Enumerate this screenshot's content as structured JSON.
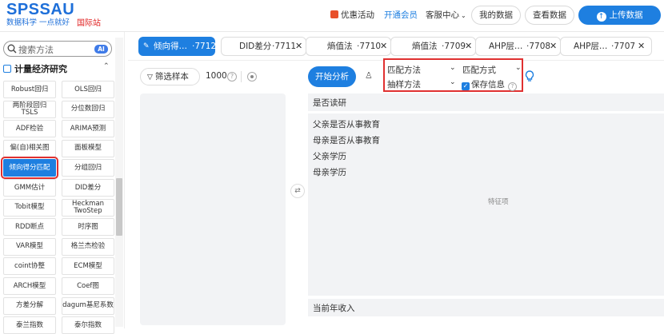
{
  "header": {
    "logo": "SPSSAU",
    "slogan": "数据科学 一点就好",
    "intl": "国际站",
    "nav": {
      "promo": "优惠活动",
      "vip": "开通会员",
      "customer": "客服中心"
    },
    "my_data": "我的数据",
    "view_data": "查看数据",
    "upload": "上传数据"
  },
  "sidebar": {
    "search_placeholder": "搜索方法",
    "ai_badge": "AI",
    "category": "计量经济研究",
    "methods": [
      [
        "Robust回归",
        "OLS回归"
      ],
      [
        "两阶段回归 TSLS",
        "分位数回归"
      ],
      [
        "ADF检验",
        "ARIMA预测"
      ],
      [
        "偏(自)相关图",
        "面板模型"
      ],
      [
        "倾向得分匹配",
        "分组回归"
      ],
      [
        "GMM估计",
        "DID差分"
      ],
      [
        "Tobit模型",
        "Heckman TwoStep"
      ],
      [
        "RDD断点",
        "时序图"
      ],
      [
        "VAR模型",
        "格兰杰检验"
      ],
      [
        "coint协整",
        "ECM模型"
      ],
      [
        "ARCH模型",
        "Coef图"
      ],
      [
        "方差分解",
        "dagum基尼系数"
      ],
      [
        "泰兰指数",
        "泰尔指数"
      ]
    ]
  },
  "tabs": [
    {
      "label": "倾向得…",
      "id": "·7712"
    },
    {
      "label": "DID差分",
      "id": "·7711"
    },
    {
      "label": "熵值法",
      "id": "·7710"
    },
    {
      "label": "熵值法",
      "id": "·7709"
    },
    {
      "label": "AHP层…",
      "id": "·7708"
    },
    {
      "label": "AHP层…",
      "id": "·7707"
    }
  ],
  "toolbar": {
    "filter": "筛选样本",
    "count": "1000",
    "start": "开始分析"
  },
  "options": {
    "match_method": "匹配方法",
    "match_mode": "匹配方式",
    "sample_method": "抽样方法",
    "save_info": "保存信息"
  },
  "fields": {
    "target": "是否读研",
    "features": [
      "父亲是否从事教育",
      "母亲是否从事教育",
      "父亲学历",
      "母亲学历"
    ],
    "features_hint": "特征项",
    "covariate": "当前年收入"
  }
}
